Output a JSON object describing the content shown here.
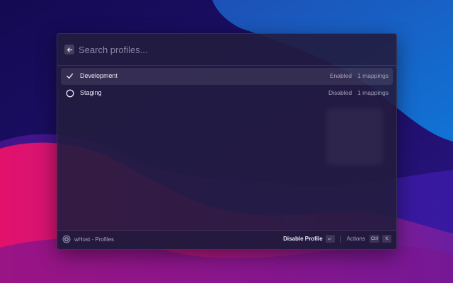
{
  "search": {
    "placeholder": "Search profiles..."
  },
  "profiles": [
    {
      "name": "Development",
      "status": "Enabled",
      "mappings": "1 mappings",
      "selected": true,
      "icon": "checkmark-icon"
    },
    {
      "name": "Staging",
      "status": "Disabled",
      "mappings": "1 mappings",
      "selected": false,
      "icon": "circle-icon"
    }
  ],
  "footer": {
    "app_title": "wHost - Profiles",
    "primary_action": "Disable Profile",
    "primary_key": "↵",
    "actions_label": "Actions",
    "actions_key_mod": "Ctrl",
    "actions_key": "K"
  },
  "colors": {
    "accent_pink": "#e0156f",
    "wallpaper_blue": "#1460c8",
    "window_bg": "#221c3e"
  }
}
